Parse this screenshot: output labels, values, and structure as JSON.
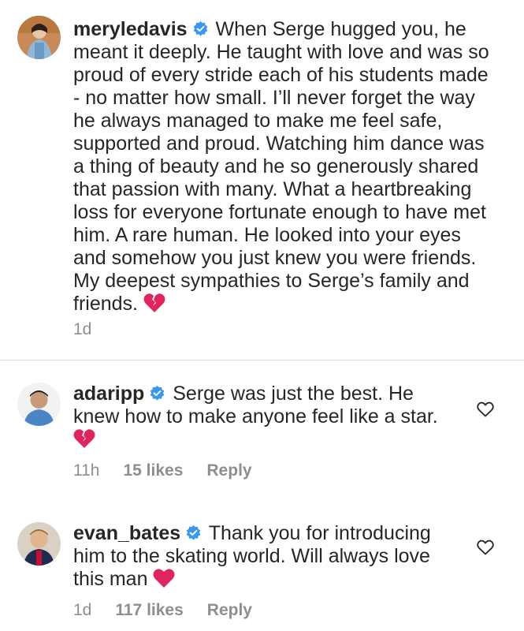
{
  "comments": [
    {
      "username": "meryledavis",
      "verified": true,
      "text": "When Serge hugged you, he meant it deeply. He taught with love and was so proud of every stride each of his students made - no matter how small. I’ll never forget the way he always managed to make me feel safe, supported and proud. Watching him dance was a thing of beauty and he so generously shared that passion with many. What a heartbreaking loss for everyone fortunate enough to have met him. A rare human. He looked into your eyes and somehow you just knew you were friends. My deepest sympathies to Serge’s family and friends.",
      "emoji": "broken-heart-icon",
      "time": "1d"
    },
    {
      "username": "adaripp",
      "verified": true,
      "text": "Serge was just the best. He knew how to make anyone feel like a star.",
      "emoji": "broken-heart-icon",
      "time": "11h",
      "likes": "15 likes",
      "reply": "Reply"
    },
    {
      "username": "evan_bates",
      "verified": true,
      "text": "Thank you for introducing him to the skating world. Will always love this man",
      "emoji": "red-heart-icon",
      "time": "1d",
      "likes": "117 likes",
      "reply": "Reply"
    }
  ],
  "colors": {
    "text": "#262626",
    "meta": "#8e8e8e",
    "verified": "#3897f0",
    "heart": "#e0245e",
    "divider": "#dbdbdb"
  }
}
